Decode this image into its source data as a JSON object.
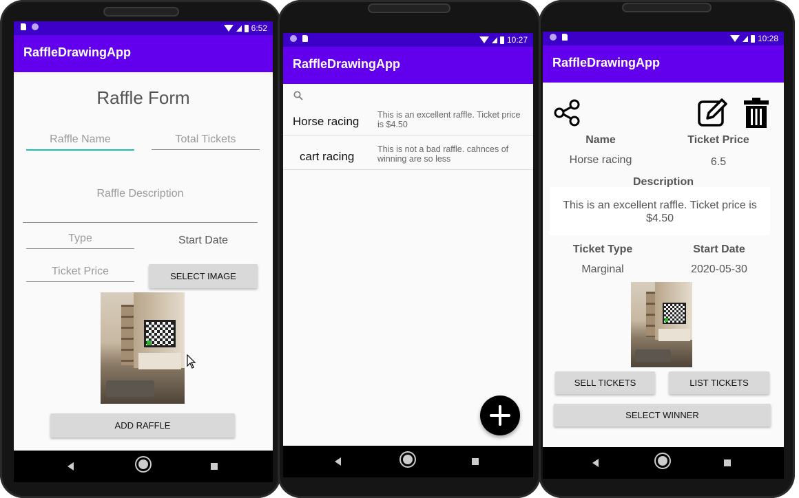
{
  "app_title": "RaffleDrawingApp",
  "phones": [
    {
      "status_time": "6:52",
      "form": {
        "heading": "Raffle Form",
        "raffle_name_placeholder": "Raffle Name",
        "total_tickets_placeholder": "Total Tickets",
        "description_placeholder": "Raffle Description",
        "type_placeholder": "Type",
        "start_date_label": "Start Date",
        "ticket_price_placeholder": "Ticket Price",
        "select_image_label": "SELECT IMAGE",
        "add_raffle_label": "ADD RAFFLE"
      }
    },
    {
      "status_time": "10:27",
      "list": {
        "search_icon": "search-icon",
        "items": [
          {
            "name": "Horse racing",
            "description": "This is an excellent raffle. Ticket price is $4.50"
          },
          {
            "name": "cart racing",
            "description": "This is not  a bad raffle. cahnces of winning are so less"
          }
        ],
        "fab_icon": "add-icon"
      }
    },
    {
      "status_time": "10:28",
      "detail": {
        "share_icon": "share-icon",
        "edit_icon": "edit-icon",
        "delete_icon": "delete-icon",
        "name_label": "Name",
        "name_value": "Horse racing",
        "price_label": "Ticket Price",
        "price_value": "6.5",
        "description_label": "Description",
        "description_value": "This is an excellent raffle. Ticket price is $4.50",
        "ticket_type_label": "Ticket Type",
        "ticket_type_value": "Marginal",
        "start_date_label": "Start Date",
        "start_date_value": "2020-05-30",
        "sell_tickets_label": "SELL TICKETS",
        "list_tickets_label": "LIST TICKETS",
        "select_winner_label": "SELECT WINNER"
      }
    }
  ],
  "colors": {
    "primary": "#6200ee",
    "primary_dark": "#3d00c9",
    "accent_underline": "#1dbfb0",
    "button_gray": "#d9d9d9"
  }
}
